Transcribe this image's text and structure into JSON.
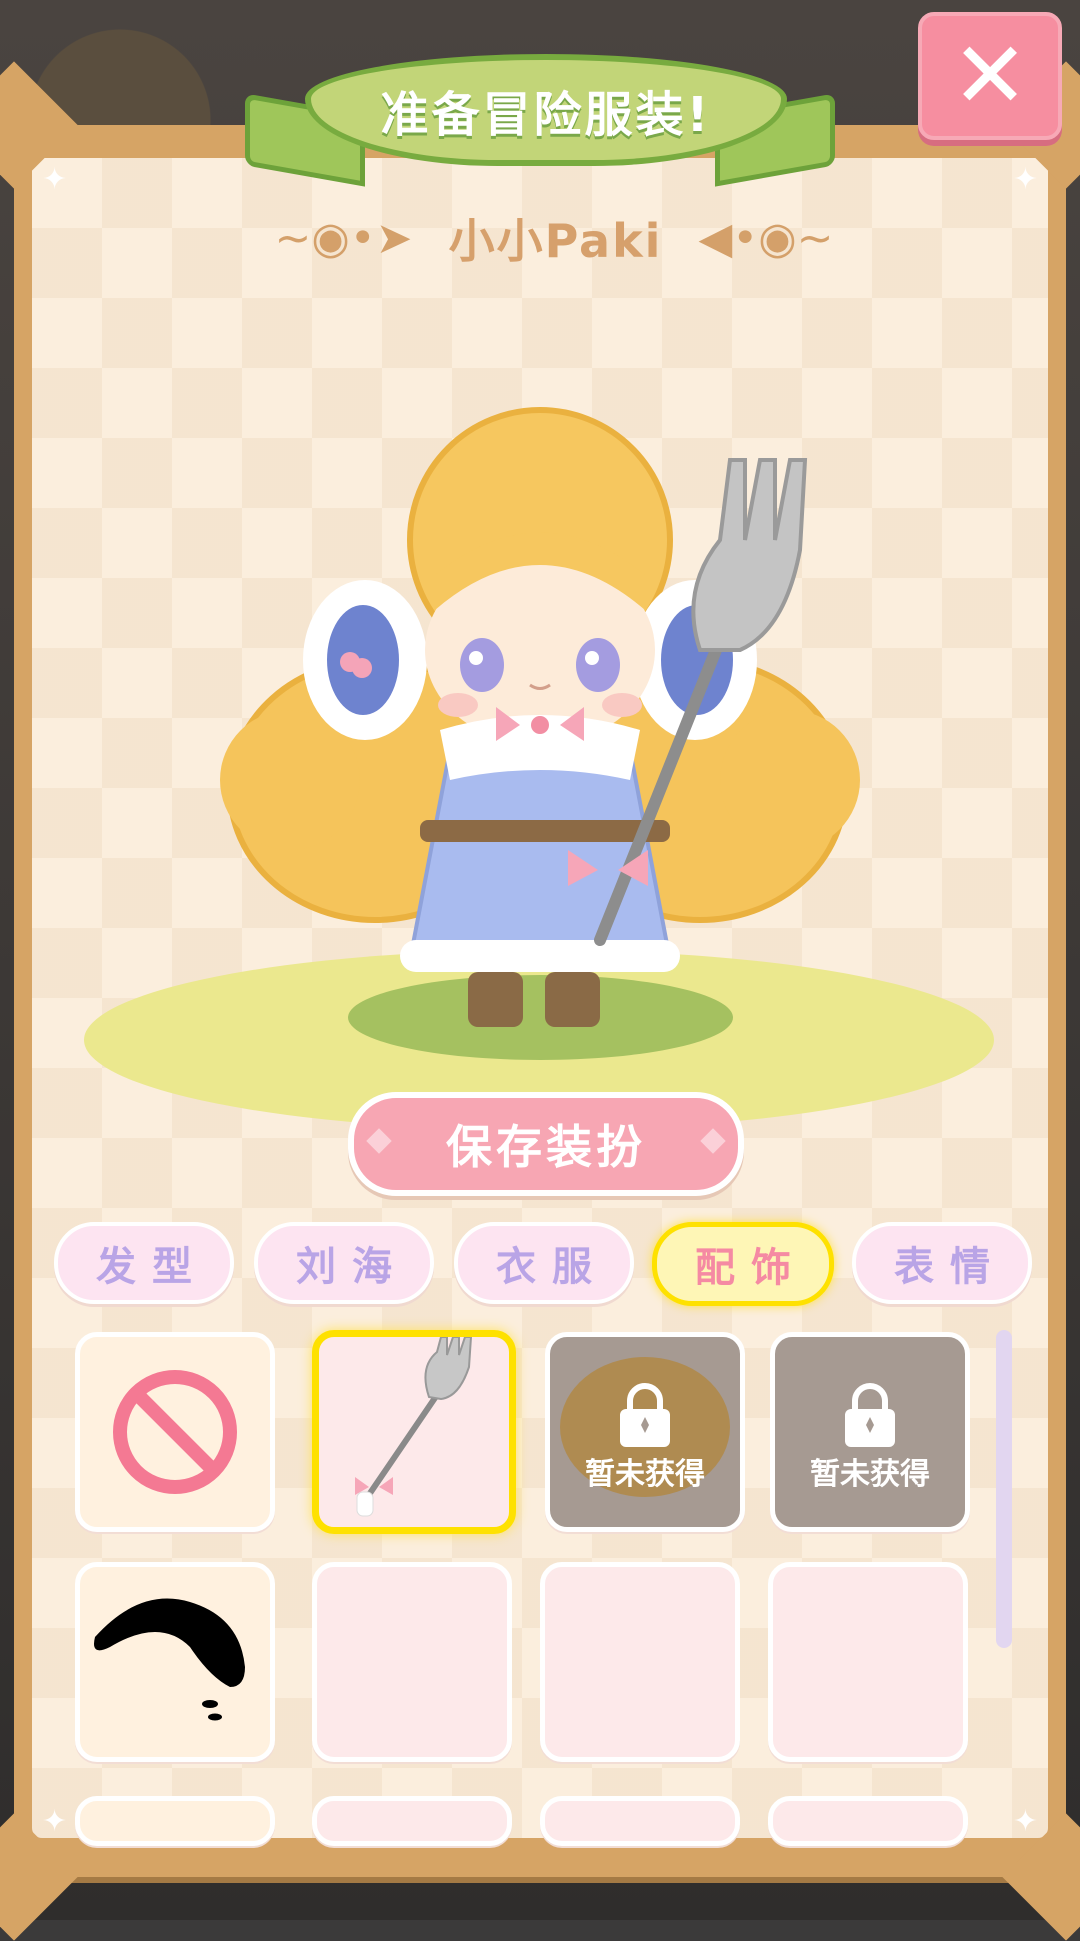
{
  "title": "准备冒险服装!",
  "close_label": "✕",
  "character_name": "小小Paki",
  "save_button": "保存装扮",
  "tabs": [
    {
      "label": "发型",
      "active": false
    },
    {
      "label": "刘海",
      "active": false
    },
    {
      "label": "衣服",
      "active": false
    },
    {
      "label": "配饰",
      "active": true
    },
    {
      "label": "表情",
      "active": false
    }
  ],
  "items": [
    {
      "kind": "none",
      "icon": "no-entry-icon"
    },
    {
      "kind": "fork",
      "icon": "fork-accessory-icon",
      "selected": true
    },
    {
      "kind": "locked",
      "icon": "lock-icon",
      "label": "暂未获得"
    },
    {
      "kind": "locked",
      "icon": "lock-icon",
      "label": "暂未获得"
    },
    {
      "kind": "eyebrow",
      "icon": "eyebrow-accessory-icon"
    },
    {
      "kind": "empty"
    },
    {
      "kind": "empty"
    },
    {
      "kind": "empty"
    }
  ],
  "colors": {
    "accent_pink": "#f7a6b3",
    "tab_text": "#b9a4e6",
    "active_tab": "#fee100",
    "frame": "#d6a465"
  }
}
